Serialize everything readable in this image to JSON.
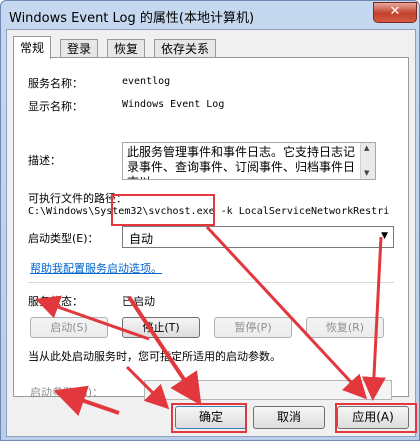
{
  "window": {
    "title": "Windows Event Log 的属性(本地计算机)",
    "close_glyph": "✕"
  },
  "tabs": [
    {
      "label": "常规",
      "active": true
    },
    {
      "label": "登录",
      "active": false
    },
    {
      "label": "恢复",
      "active": false
    },
    {
      "label": "依存关系",
      "active": false
    }
  ],
  "general": {
    "service_name_label": "服务名称：",
    "service_name_value": "eventlog",
    "display_name_label": "显示名称：",
    "display_name_value": "Windows Event Log",
    "description_label": "描述：",
    "description_value": "此服务管理事件和事件日志。它支持日志记录事件、查询事件、订阅事件、归档事件日志以",
    "path_label": "可执行文件的路径：",
    "path_value": "C:\\Windows\\System32\\svchost.exe -k LocalServiceNetworkRestri",
    "startup_type_label": "启动类型(E)：",
    "startup_type_value": "自动",
    "help_link": "帮助我配置服务启动选项。",
    "status_label": "服务状态：",
    "status_value": "已启动",
    "start_button": "启动(S)",
    "stop_button": "停止(T)",
    "pause_button": "暂停(P)",
    "resume_button": "恢复(R)",
    "hint_text": "当从此处启动服务时，您可指定所适用的启动参数。",
    "params_label": "启动参数(M)：",
    "params_value": ""
  },
  "footer": {
    "ok_button": "确定",
    "cancel_button": "取消",
    "apply_button": "应用(A)"
  },
  "annotations": {
    "highlight_color": "#e2373c"
  }
}
